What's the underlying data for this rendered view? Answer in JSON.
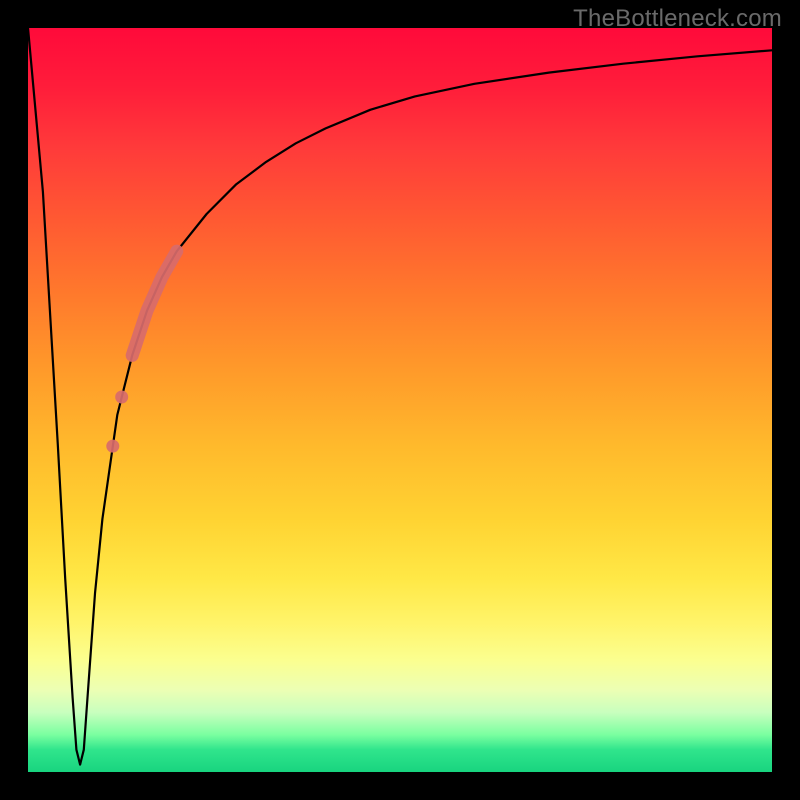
{
  "watermark": "TheBottleneck.com",
  "colors": {
    "frame": "#000000",
    "curve": "#000000",
    "valley_fill": "#18d47f",
    "marker": "#d86b6b"
  },
  "chart_data": {
    "type": "line",
    "title": "",
    "xlabel": "",
    "ylabel": "",
    "xlim": [
      0,
      100
    ],
    "ylim": [
      0,
      100
    ],
    "grid": false,
    "series": [
      {
        "name": "bottleneck-curve",
        "x": [
          0,
          2,
          4,
          5,
          6,
          6.5,
          7,
          7.5,
          8,
          9,
          10,
          12,
          14,
          16,
          18,
          20,
          24,
          28,
          32,
          36,
          40,
          46,
          52,
          60,
          70,
          80,
          90,
          100
        ],
        "y": [
          100,
          78,
          44,
          26,
          10,
          3,
          1,
          3,
          10,
          24,
          34,
          48,
          56,
          62,
          66.5,
          70,
          75,
          79,
          82,
          84.5,
          86.5,
          89,
          90.8,
          92.5,
          94,
          95.2,
          96.2,
          97
        ]
      }
    ],
    "annotations": {
      "highlighted_region": {
        "description": "pink thick marker band on rising slope",
        "approx_x_range": [
          14,
          20
        ],
        "approx_y_range": [
          47,
          70
        ]
      }
    }
  }
}
